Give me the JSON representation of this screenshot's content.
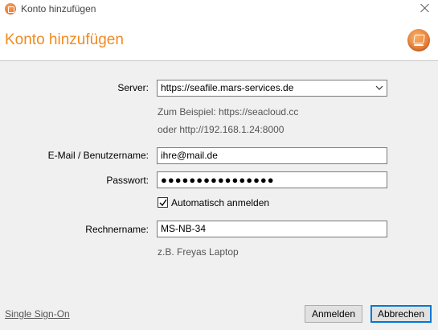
{
  "window": {
    "title": "Konto hinzufügen"
  },
  "header": {
    "title": "Konto hinzufügen"
  },
  "form": {
    "server": {
      "label": "Server:",
      "value": "https://seafile.mars-services.de",
      "hint_line1": "Zum Beispiel: https://seacloud.cc",
      "hint_line2": "oder http://192.168.1.24:8000"
    },
    "email": {
      "label": "E-Mail / Benutzername:",
      "value": "ihre@mail.de"
    },
    "password": {
      "label": "Passwort:",
      "value": "●●●●●●●●●●●●●●●●"
    },
    "auto_login": {
      "label": "Automatisch anmelden",
      "checked": true
    },
    "computer_name": {
      "label": "Rechnername:",
      "value": "MS-NB-34",
      "hint": "z.B. Freyas Laptop"
    }
  },
  "footer": {
    "sso_link": "Single Sign-On",
    "login_button": "Anmelden",
    "cancel_button": "Abbrechen"
  },
  "colors": {
    "accent": "#f28a21",
    "focus": "#0078d7"
  },
  "icons": [
    "seafile-app-icon",
    "close-icon",
    "seafile-logo-icon",
    "chevron-down-icon",
    "checkmark-icon"
  ]
}
